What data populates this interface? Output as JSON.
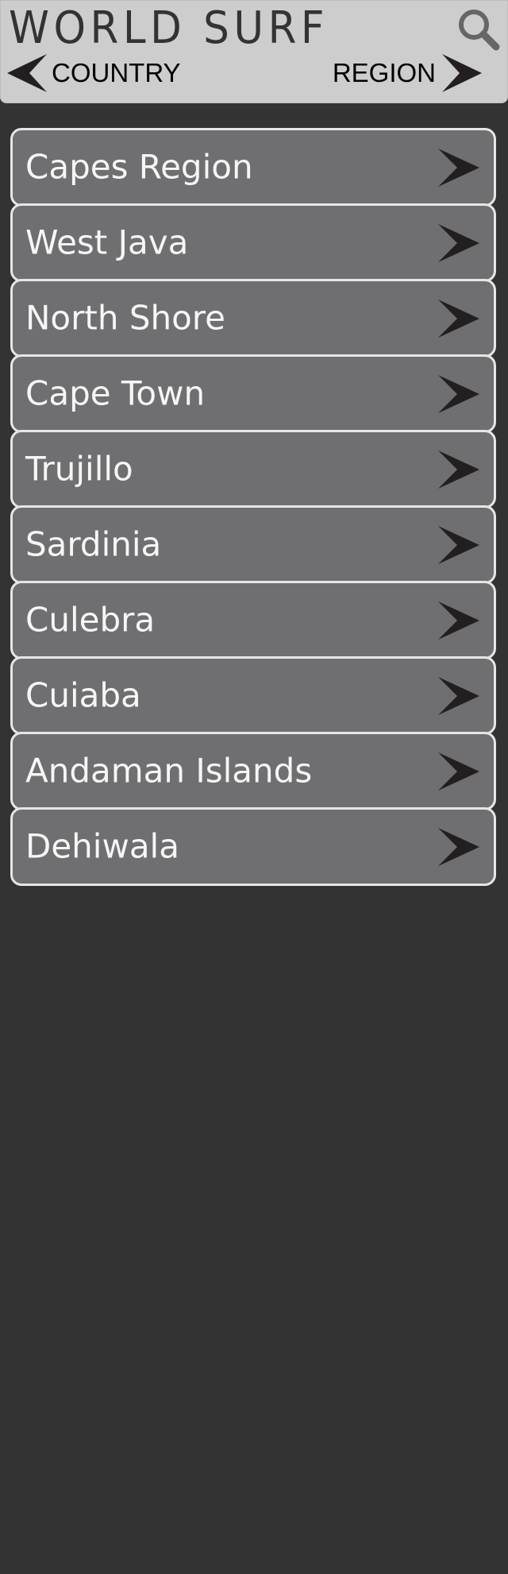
{
  "header": {
    "title": "WORLD SURF",
    "search_icon": "search-icon",
    "nav_left": {
      "label": "COUNTRY",
      "icon": "arrow-left-icon"
    },
    "nav_right": {
      "label": "REGION",
      "icon": "arrow-right-icon"
    }
  },
  "list": {
    "item_icon": "chevron-right-icon",
    "items": [
      {
        "label": "Capes Region"
      },
      {
        "label": "West Java"
      },
      {
        "label": "North Shore"
      },
      {
        "label": "Cape Town"
      },
      {
        "label": "Trujillo"
      },
      {
        "label": "Sardinia"
      },
      {
        "label": "Culebra"
      },
      {
        "label": "Cuiaba"
      },
      {
        "label": "Andaman Islands"
      },
      {
        "label": "Dehiwala"
      }
    ]
  },
  "colors": {
    "background": "#333333",
    "header_background": "#cdcdcd",
    "item_background": "#6f6f71",
    "item_border": "#e6e6e6",
    "arrow": "#231f20"
  }
}
